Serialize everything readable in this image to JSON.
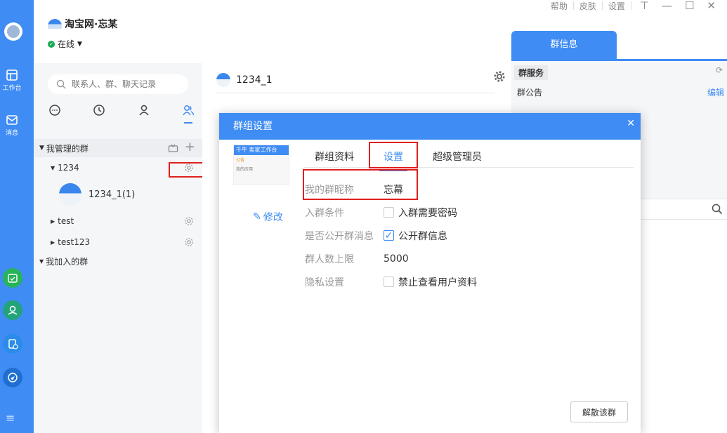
{
  "account": {
    "brand": "淘宝网",
    "name": "忘某",
    "status": "在线"
  },
  "top_nav": {
    "help": "帮助",
    "skin": "皮肤",
    "settings": "设置"
  },
  "rail": {
    "workbench": "工作台",
    "messages": "消息"
  },
  "contacts": {
    "search_placeholder": "联系人、群、聊天记录",
    "groups_managed": "我管理的群",
    "group_1234": "1234",
    "member_1234_1": "1234_1(1)",
    "group_test": "test",
    "group_test123": "test123",
    "groups_joined": "我加入的群"
  },
  "chat": {
    "title": "1234_1"
  },
  "info": {
    "tab": "群信息",
    "service": "群服务",
    "notice": "群公告",
    "edit": "编辑"
  },
  "dialog": {
    "title": "群组设置",
    "preview_brand": "千牛",
    "preview_sub": "卖家工作台",
    "preview_line1": "公告",
    "preview_line2": "我的应用",
    "modify": "修改",
    "tabs": [
      "群组资料",
      "设置",
      "超级管理员"
    ],
    "fields": {
      "nickname_label": "我的群昵称",
      "nickname_value": "忘幕",
      "join_label": "入群条件",
      "join_value": "入群需要密码",
      "public_label": "是否公开群消息",
      "public_value": "公开群信息",
      "limit_label": "群人数上限",
      "limit_value": "5000",
      "privacy_label": "隐私设置",
      "privacy_value": "禁止查看用户资料"
    },
    "disband": "解散该群"
  },
  "colors": {
    "accent": "#3f8cf4",
    "highlight": "#e01f1f"
  }
}
